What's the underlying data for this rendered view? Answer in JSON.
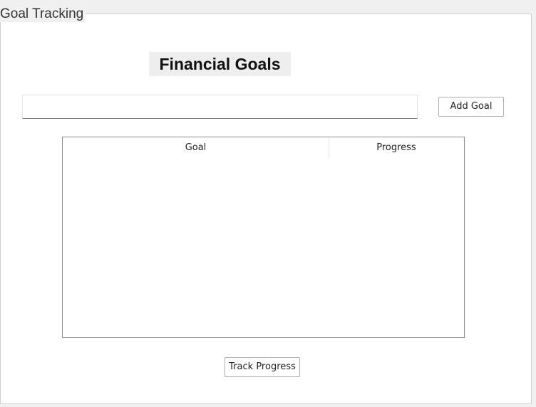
{
  "group": {
    "title": "Goal Tracking"
  },
  "heading": "Financial Goals",
  "goal_input": {
    "value": "",
    "placeholder": ""
  },
  "buttons": {
    "add_goal": "Add Goal",
    "track_progress": "Track Progress"
  },
  "table": {
    "columns": [
      "Goal",
      "Progress"
    ],
    "rows": []
  }
}
